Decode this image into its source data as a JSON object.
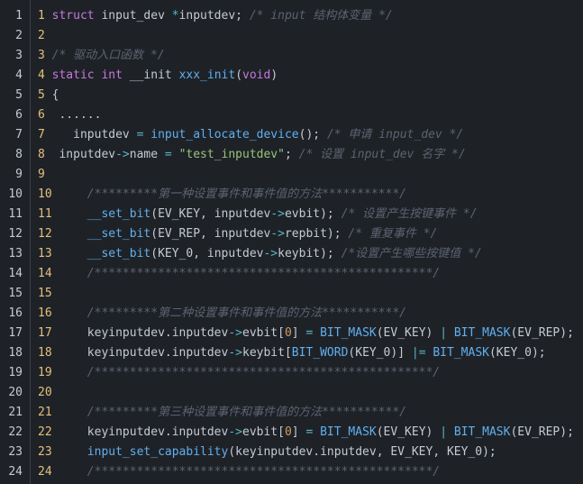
{
  "lines": [
    {
      "num": "1",
      "inner_num": "1",
      "indent": "",
      "tokens": [
        {
          "t": "struct",
          "c": "kw"
        },
        {
          "t": " input_dev ",
          "c": "pl"
        },
        {
          "t": "*",
          "c": "op"
        },
        {
          "t": "inputdev; ",
          "c": "pl"
        },
        {
          "t": "/* input 结构体变量 */",
          "c": "cm"
        }
      ]
    },
    {
      "num": "2",
      "inner_num": "2",
      "indent": "",
      "tokens": []
    },
    {
      "num": "3",
      "inner_num": "3",
      "indent": "",
      "tokens": [
        {
          "t": "/* 驱动入口函数 */",
          "c": "cm"
        }
      ]
    },
    {
      "num": "4",
      "inner_num": "4",
      "indent": "",
      "tokens": [
        {
          "t": "static",
          "c": "kw"
        },
        {
          "t": " ",
          "c": "pl"
        },
        {
          "t": "int",
          "c": "kw"
        },
        {
          "t": " __init ",
          "c": "pl"
        },
        {
          "t": "xxx_init",
          "c": "fn"
        },
        {
          "t": "(",
          "c": "pl"
        },
        {
          "t": "void",
          "c": "kw"
        },
        {
          "t": ")",
          "c": "pl"
        }
      ]
    },
    {
      "num": "5",
      "inner_num": "5",
      "indent": "",
      "tokens": [
        {
          "t": "{",
          "c": "pl"
        }
      ]
    },
    {
      "num": "6",
      "inner_num": "6",
      "indent": "",
      "tokens": [
        {
          "t": " ......",
          "c": "pl"
        }
      ]
    },
    {
      "num": "7",
      "inner_num": "7",
      "indent": "   ",
      "tokens": [
        {
          "t": "inputdev ",
          "c": "pl"
        },
        {
          "t": "=",
          "c": "op"
        },
        {
          "t": " ",
          "c": "pl"
        },
        {
          "t": "input_allocate_device",
          "c": "fn"
        },
        {
          "t": "(); ",
          "c": "pl"
        },
        {
          "t": "/* 申请 input_dev */",
          "c": "cm"
        }
      ]
    },
    {
      "num": "8",
      "inner_num": "8",
      "indent": " ",
      "tokens": [
        {
          "t": "inputdev",
          "c": "pl"
        },
        {
          "t": "->",
          "c": "op"
        },
        {
          "t": "name ",
          "c": "pl"
        },
        {
          "t": "=",
          "c": "op"
        },
        {
          "t": " ",
          "c": "pl"
        },
        {
          "t": "\"test_inputdev\"",
          "c": "str"
        },
        {
          "t": "; ",
          "c": "pl"
        },
        {
          "t": "/* 设置 input_dev 名字 */",
          "c": "cm"
        }
      ]
    },
    {
      "num": "9",
      "inner_num": "9",
      "indent": "",
      "tokens": []
    },
    {
      "num": "10",
      "inner_num": "10",
      "indent": "    ",
      "tokens": [
        {
          "t": "/*********第一种设置事件和事件值的方法***********/",
          "c": "cm"
        }
      ]
    },
    {
      "num": "11",
      "inner_num": "11",
      "indent": "    ",
      "tokens": [
        {
          "t": "__set_bit",
          "c": "fn"
        },
        {
          "t": "(EV_KEY, inputdev",
          "c": "pl"
        },
        {
          "t": "->",
          "c": "op"
        },
        {
          "t": "evbit); ",
          "c": "pl"
        },
        {
          "t": "/* 设置产生按键事件 */",
          "c": "cm"
        }
      ]
    },
    {
      "num": "12",
      "inner_num": "12",
      "indent": "    ",
      "tokens": [
        {
          "t": "__set_bit",
          "c": "fn"
        },
        {
          "t": "(EV_REP, inputdev",
          "c": "pl"
        },
        {
          "t": "->",
          "c": "op"
        },
        {
          "t": "repbit); ",
          "c": "pl"
        },
        {
          "t": "/* 重复事件 */",
          "c": "cm"
        }
      ]
    },
    {
      "num": "13",
      "inner_num": "13",
      "indent": "    ",
      "tokens": [
        {
          "t": "__set_bit",
          "c": "fn"
        },
        {
          "t": "(KEY_0, inputdev",
          "c": "pl"
        },
        {
          "t": "->",
          "c": "op"
        },
        {
          "t": "keybit); ",
          "c": "pl"
        },
        {
          "t": "/*设置产生哪些按键值 */",
          "c": "cm"
        }
      ]
    },
    {
      "num": "14",
      "inner_num": "14",
      "indent": "    ",
      "tokens": [
        {
          "t": "/************************************************/",
          "c": "cm"
        }
      ]
    },
    {
      "num": "15",
      "inner_num": "15",
      "indent": "",
      "tokens": []
    },
    {
      "num": "16",
      "inner_num": "16",
      "indent": "    ",
      "tokens": [
        {
          "t": "/*********第二种设置事件和事件值的方法***********/",
          "c": "cm"
        }
      ]
    },
    {
      "num": "17",
      "inner_num": "17",
      "indent": "    ",
      "tokens": [
        {
          "t": "keyinputdev.inputdev",
          "c": "pl"
        },
        {
          "t": "->",
          "c": "op"
        },
        {
          "t": "evbit[",
          "c": "pl"
        },
        {
          "t": "0",
          "c": "num"
        },
        {
          "t": "] ",
          "c": "pl"
        },
        {
          "t": "=",
          "c": "op"
        },
        {
          "t": " ",
          "c": "pl"
        },
        {
          "t": "BIT_MASK",
          "c": "mac"
        },
        {
          "t": "(EV_KEY) ",
          "c": "pl"
        },
        {
          "t": "|",
          "c": "op"
        },
        {
          "t": " ",
          "c": "pl"
        },
        {
          "t": "BIT_MASK",
          "c": "mac"
        },
        {
          "t": "(EV_REP);",
          "c": "pl"
        }
      ]
    },
    {
      "num": "18",
      "inner_num": "18",
      "indent": "    ",
      "tokens": [
        {
          "t": "keyinputdev.inputdev",
          "c": "pl"
        },
        {
          "t": "->",
          "c": "op"
        },
        {
          "t": "keybit[",
          "c": "pl"
        },
        {
          "t": "BIT_WORD",
          "c": "mac"
        },
        {
          "t": "(KEY_0)] ",
          "c": "pl"
        },
        {
          "t": "|=",
          "c": "op"
        },
        {
          "t": " ",
          "c": "pl"
        },
        {
          "t": "BIT_MASK",
          "c": "mac"
        },
        {
          "t": "(KEY_0);",
          "c": "pl"
        }
      ]
    },
    {
      "num": "19",
      "inner_num": "19",
      "indent": "    ",
      "tokens": [
        {
          "t": "/************************************************/",
          "c": "cm"
        }
      ]
    },
    {
      "num": "20",
      "inner_num": "20",
      "indent": "",
      "tokens": []
    },
    {
      "num": "21",
      "inner_num": "21",
      "indent": "    ",
      "tokens": [
        {
          "t": "/*********第三种设置事件和事件值的方法***********/",
          "c": "cm"
        }
      ]
    },
    {
      "num": "22",
      "inner_num": "22",
      "indent": "    ",
      "tokens": [
        {
          "t": "keyinputdev.inputdev",
          "c": "pl"
        },
        {
          "t": "->",
          "c": "op"
        },
        {
          "t": "evbit[",
          "c": "pl"
        },
        {
          "t": "0",
          "c": "num"
        },
        {
          "t": "] ",
          "c": "pl"
        },
        {
          "t": "=",
          "c": "op"
        },
        {
          "t": " ",
          "c": "pl"
        },
        {
          "t": "BIT_MASK",
          "c": "mac"
        },
        {
          "t": "(EV_KEY) ",
          "c": "pl"
        },
        {
          "t": "|",
          "c": "op"
        },
        {
          "t": " ",
          "c": "pl"
        },
        {
          "t": "BIT_MASK",
          "c": "mac"
        },
        {
          "t": "(EV_REP);",
          "c": "pl"
        }
      ]
    },
    {
      "num": "23",
      "inner_num": "23",
      "indent": "    ",
      "tokens": [
        {
          "t": "input_set_capability",
          "c": "fn"
        },
        {
          "t": "(keyinputdev.inputdev, EV_KEY, KEY_0);",
          "c": "pl"
        }
      ]
    },
    {
      "num": "24",
      "inner_num": "24",
      "indent": "    ",
      "tokens": [
        {
          "t": "/************************************************/",
          "c": "cm"
        }
      ]
    }
  ],
  "colors": {
    "background": "#1e2227",
    "text": "#c5cad3",
    "keyword": "#c678dd",
    "function": "#61afef",
    "string": "#98c379",
    "comment": "#5c6370",
    "number": "#d19a66",
    "operator": "#56b6c2",
    "inner_line_number": "#e5c07b"
  }
}
